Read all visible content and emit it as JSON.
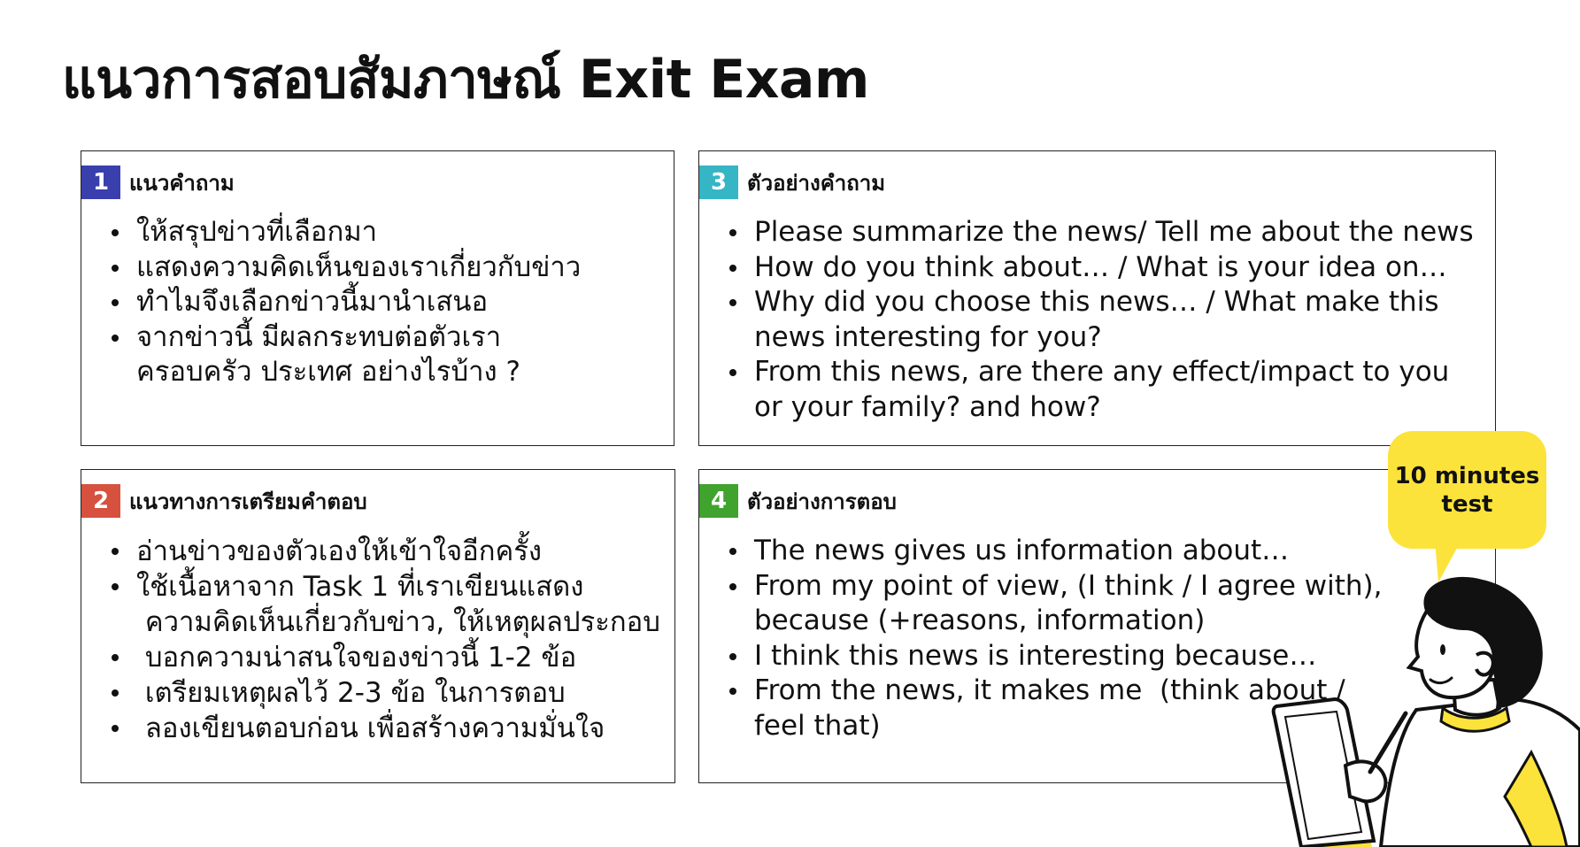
{
  "title": "แนวการสอบสัมภาษณ์ Exit Exam",
  "panels": {
    "p1": {
      "number": "1",
      "label": "แนวคำถาม",
      "color": "#3a3fae",
      "items": [
        {
          "lines": [
            "ให้สรุปข่าวที่เลือกมา"
          ]
        },
        {
          "lines": [
            "แสดงความคิดเห็นของเราเกี่ยวกับข่าว"
          ]
        },
        {
          "lines": [
            "ทำไมจึงเลือกข่าวนี้มานำเสนอ"
          ]
        },
        {
          "lines": [
            "จากข่าวนี้ มีผลกระทบต่อตัวเรา",
            "ครอบครัว ประเทศ อย่างไรบ้าง ?"
          ]
        }
      ]
    },
    "p2": {
      "number": "2",
      "label": "แนวทางการเตรียมคำตอบ",
      "color": "#d6513e",
      "items": [
        {
          "lines": [
            "อ่านข่าวของตัวเองให้เข้าใจอีกครั้ง"
          ]
        },
        {
          "lines": [
            "ใช้เนื้อหาจาก Task 1 ที่เราเขียนแสดง",
            " ความคิดเห็นเกี่ยวกับข่าว, ให้เหตุผลประกอบ"
          ]
        },
        {
          "lines": [
            " บอกความน่าสนใจของข่าวนี้ 1-2 ข้อ"
          ]
        },
        {
          "lines": [
            " เตรียมเหตุผลไว้ 2-3 ข้อ ในการตอบ"
          ]
        },
        {
          "lines": [
            " ลองเขียนตอบก่อน เพื่อสร้างความมั่นใจ"
          ]
        }
      ]
    },
    "p3": {
      "number": "3",
      "label": "ตัวอย่างคำถาม",
      "color": "#36b5c4",
      "items": [
        {
          "lines": [
            "Please summarize the news/ Tell me about the news"
          ]
        },
        {
          "lines": [
            "How do you think about… / What is your idea on…"
          ]
        },
        {
          "lines": [
            "Why did you choose this news… / What make this",
            "news interesting for you?"
          ]
        },
        {
          "lines": [
            "From this news, are there any effect/impact to you",
            "or your family? and how?"
          ]
        }
      ]
    },
    "p4": {
      "number": "4",
      "label": "ตัวอย่างการตอบ",
      "color": "#3fa32d",
      "items": [
        {
          "lines": [
            "The news gives us information about…"
          ]
        },
        {
          "lines": [
            "From my point of view, (I think / I agree with),",
            "because (+reasons, information)"
          ]
        },
        {
          "lines": [
            "I think this news is interesting because…"
          ]
        },
        {
          "lines": [
            "From the news, it makes me  (think about /",
            "feel that)"
          ]
        }
      ]
    }
  },
  "bubble": {
    "line1": "10 minutes",
    "line2": "test",
    "color": "#fbe33b"
  },
  "illustration": {
    "icon": "person-holding-tablet"
  }
}
